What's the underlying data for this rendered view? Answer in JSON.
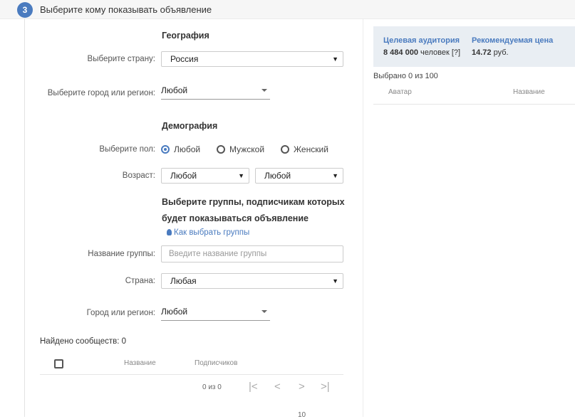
{
  "header": {
    "step": "3",
    "title": "Выберите кому показывать объявление"
  },
  "geography": {
    "title": "География",
    "country_label": "Выберите страну:",
    "country_value": "Россия",
    "city_label": "Выберите город или регион:",
    "city_value": "Любой"
  },
  "demography": {
    "title": "Демография",
    "gender_label": "Выберите пол:",
    "gender_options": [
      "Любой",
      "Мужской",
      "Женский"
    ],
    "gender_selected": "Любой",
    "age_label": "Возраст:",
    "age_from": "Любой",
    "age_to": "Любой"
  },
  "groups": {
    "title_line1": "Выберите группы, подписчикам которых",
    "title_line2": "будет показываться объявление",
    "help_link": "Как выбрать группы",
    "name_label": "Название группы:",
    "name_placeholder": "Введите название группы",
    "country_label": "Страна:",
    "country_value": "Любая",
    "city_label": "Город или регион:",
    "city_value": "Любой"
  },
  "results": {
    "found_text": "Найдено сообществ: 0",
    "columns": [
      "Название",
      "Подписчиков"
    ],
    "pager_text": "0 из 0",
    "page_size": "10"
  },
  "audience": {
    "target_header": "Целевая аудитория",
    "target_value": "8 484 000",
    "target_unit": "человек [?]",
    "price_header": "Рекомендуемая цена",
    "price_value": "14.72",
    "price_unit": "руб.",
    "selected_text": "Выбрано 0 из 100",
    "columns": [
      "Аватар",
      "Название"
    ]
  },
  "colors": {
    "accent": "#4a7bbf",
    "panel_bg": "#e9eef3"
  }
}
